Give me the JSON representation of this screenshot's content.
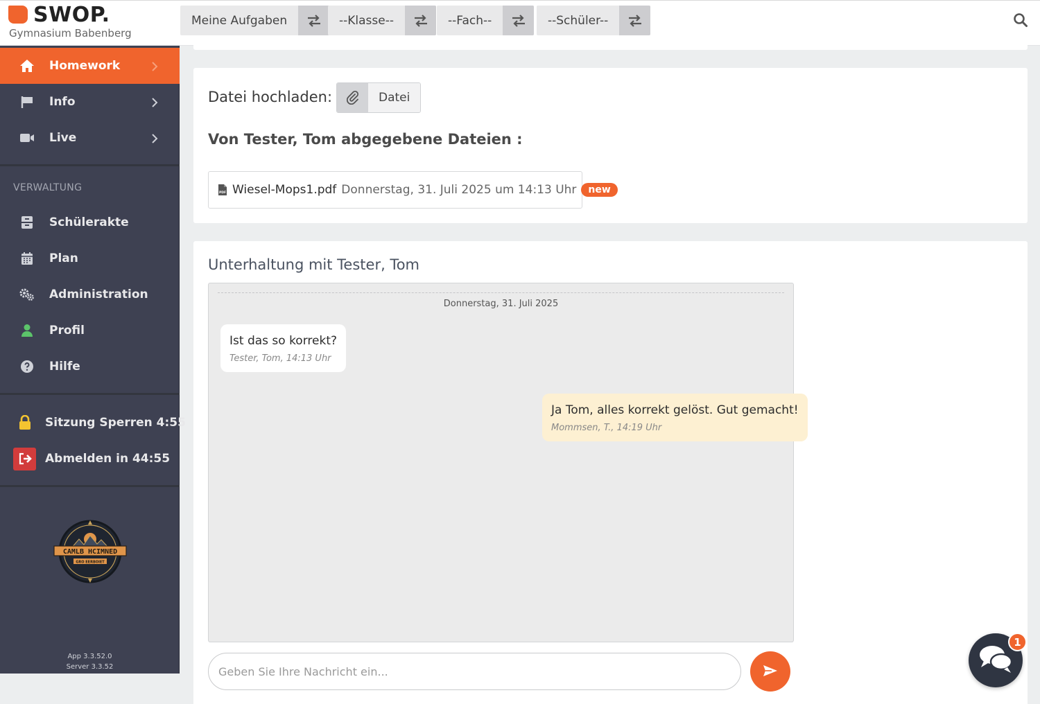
{
  "brand": {
    "title": "SWOP.",
    "subtitle": "Gymnasium Babenberg",
    "accent_color": "#f0642d"
  },
  "filters": [
    {
      "label": "Meine Aufgaben",
      "icon": "swap-icon"
    },
    {
      "label": "--Klasse--",
      "icon": "swap-icon"
    },
    {
      "label": "--Fach--",
      "icon": "swap-icon"
    },
    {
      "label": "--Schüler--",
      "icon": "swap-icon"
    }
  ],
  "sidebar": {
    "nav": [
      {
        "label": "Homework",
        "icon": "home-icon",
        "active": true
      },
      {
        "label": "Info",
        "icon": "flag-icon"
      },
      {
        "label": "Live",
        "icon": "video-icon"
      }
    ],
    "section_label": "VERWALTUNG",
    "admin": [
      {
        "label": "Schülerakte",
        "icon": "archive-icon"
      },
      {
        "label": "Plan",
        "icon": "calendar-icon"
      },
      {
        "label": "Administration",
        "icon": "gears-icon"
      },
      {
        "label": "Profil",
        "icon": "user-icon"
      },
      {
        "label": "Hilfe",
        "icon": "help-icon"
      }
    ],
    "session": [
      {
        "label": "Sitzung Sperren 4:55",
        "icon": "lock-icon"
      },
      {
        "label": "Abmelden in 44:55",
        "icon": "logout-icon"
      }
    ],
    "app_version": "App 3.3.52.0",
    "server_version": "Server 3.3.52"
  },
  "upload": {
    "label": "Datei hochladen:",
    "button_label": "Datei",
    "submitted_title": "Von Tester, Tom abgegebene Dateien :",
    "files": [
      {
        "name": "Wiesel-Mops1.pdf",
        "date": "Donnerstag, 31. Juli 2025 um 14:13 Uhr",
        "badge": "new"
      }
    ]
  },
  "chat": {
    "title": "Unterhaltung mit Tester, Tom",
    "date_divider": "Donnerstag, 31. Juli 2025",
    "messages": [
      {
        "text": "Ist das so korrekt?",
        "meta": "Tester, Tom, 14:13 Uhr",
        "direction": "incoming"
      },
      {
        "text": "Ja Tom, alles korrekt gelöst. Gut gemacht!",
        "meta": "Mommsen, T., 14:19 Uhr",
        "direction": "outgoing"
      }
    ],
    "input_placeholder": "Geben Sie Ihre Nachricht ein..."
  },
  "floating_chat": {
    "badge": "1"
  }
}
